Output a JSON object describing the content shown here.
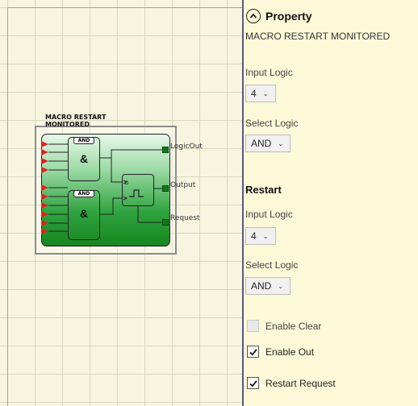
{
  "block": {
    "title": "MACRO RESTART MONITORED",
    "gate1_label": "AND",
    "gate2_label": "AND",
    "gate_symbol": "&",
    "restart_d_label": "D",
    "outputs": [
      "LogicOut",
      "Output",
      "Request"
    ]
  },
  "panel": {
    "header_title": "Property",
    "macro_name": "MACRO RESTART MONITORED",
    "input_logic_label": "Input Logic",
    "input_logic_value": "4",
    "select_logic_label": "Select Logic",
    "select_logic_value": "AND",
    "restart_section": "Restart",
    "restart_input_logic_label": "Input Logic",
    "restart_input_logic_value": "4",
    "restart_select_logic_label": "Select Logic",
    "restart_select_logic_value": "AND",
    "enable_clear_label": "Enable Clear",
    "enable_clear_checked": false,
    "enable_out_label": "Enable Out",
    "enable_out_checked": true,
    "restart_request_label": "Restart Request",
    "restart_request_checked": true
  },
  "icons": {
    "collapse": "chevron-up-circle-icon",
    "dropdown": "chevron-down-icon",
    "checkmark": "checkmark-icon"
  },
  "colors": {
    "canvas_bg": "#f7f5e0",
    "panel_bg": "#fcf9d8",
    "block_green": "#17861f",
    "input_pin_red": "#e02020",
    "output_pin_green": "#0f7a1a"
  }
}
